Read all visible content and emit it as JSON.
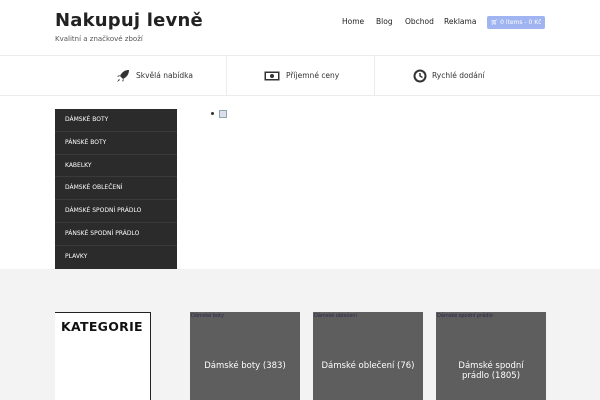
{
  "site": {
    "title": "Nakupuj levně",
    "tagline": "Kvalitní a značkové zboží"
  },
  "nav": {
    "items": [
      "Home",
      "Blog",
      "Obchod",
      "Reklama"
    ],
    "cart_label": "0 items - 0 Kč"
  },
  "features": [
    {
      "label": "Skvělá nabídka",
      "icon": "rocket-icon"
    },
    {
      "label": "Příjemné ceny",
      "icon": "money-icon"
    },
    {
      "label": "Rychlé dodání",
      "icon": "clock-icon"
    }
  ],
  "menu": {
    "items": [
      "DÁMSKÉ BOTY",
      "PÁNSKÉ BOTY",
      "KABELKY",
      "DÁMSKÉ OBLEČENÍ",
      "DÁMSKÉ SPODNÍ PRÁDLO",
      "PÁNSKÉ SPODNÍ PRÁDLO",
      "PLAVKY"
    ]
  },
  "categories": {
    "heading": "KATEGORIE",
    "cards": [
      {
        "alt": "Dámské boty",
        "label": "Dámské boty (383)"
      },
      {
        "alt": "Dámské oblečení",
        "label": "Dámské oblečení (76)"
      },
      {
        "alt": "Dámské spodní prádlo",
        "label": "Dámské spodní prádlo (1805)"
      }
    ]
  },
  "colors": {
    "menu_bg": "#2b2b2b",
    "cart_bg": "#9fb4f0",
    "card_bg": "#5e5e5e",
    "section_bg": "#f3f3f3"
  }
}
